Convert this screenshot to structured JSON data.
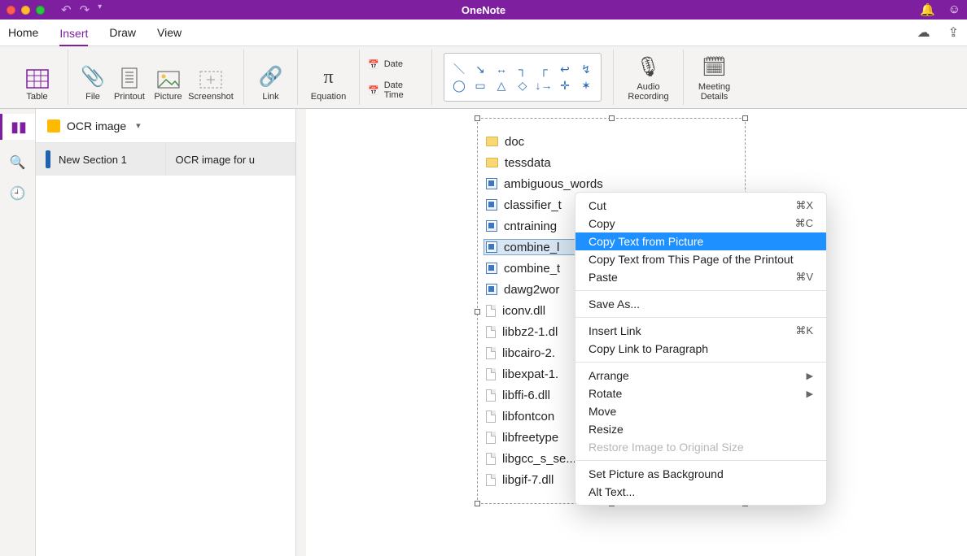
{
  "title": "OneNote",
  "menu": {
    "items": [
      "Home",
      "Insert",
      "Draw",
      "View"
    ],
    "active_index": 1
  },
  "ribbon": {
    "table": "Table",
    "file": "File",
    "printout": "Printout",
    "picture": "Picture",
    "screenshot": "Screenshot",
    "link": "Link",
    "equation": "Equation",
    "date": "Date",
    "date_time": "Date  Time",
    "audio_recording_l1": "Audio",
    "audio_recording_l2": "Recording",
    "meeting_details_l1": "Meeting",
    "meeting_details_l2": "Details"
  },
  "notebook": {
    "name": "OCR image",
    "section": "New Section 1",
    "page": "OCR image for u"
  },
  "embedded_files": [
    {
      "name": "doc",
      "type": "folder"
    },
    {
      "name": "tessdata",
      "type": "folder"
    },
    {
      "name": "ambiguous_words",
      "type": "exe"
    },
    {
      "name": "classifier_t",
      "type": "exe"
    },
    {
      "name": "cntraining",
      "type": "exe"
    },
    {
      "name": "combine_l",
      "type": "exe",
      "selected": true
    },
    {
      "name": "combine_t",
      "type": "exe"
    },
    {
      "name": "dawg2wor",
      "type": "exe"
    },
    {
      "name": "iconv.dll",
      "type": "dll"
    },
    {
      "name": "libbz2-1.dl",
      "type": "dll"
    },
    {
      "name": "libcairo-2.",
      "type": "dll"
    },
    {
      "name": "libexpat-1.",
      "type": "dll"
    },
    {
      "name": "libffi-6.dll",
      "type": "dll"
    },
    {
      "name": "libfontcon",
      "type": "dll"
    },
    {
      "name": "libfreetype",
      "type": "dll"
    },
    {
      "name": "libgcc_s_se...",
      "type": "dll"
    },
    {
      "name": "libgif-7.dll",
      "type": "dll"
    }
  ],
  "context_menu": {
    "groups": [
      [
        {
          "label": "Cut",
          "shortcut": "⌘X"
        },
        {
          "label": "Copy",
          "shortcut": "⌘C"
        },
        {
          "label": "Copy Text from Picture",
          "highlight": true
        },
        {
          "label": "Copy Text from This Page of the Printout"
        },
        {
          "label": "Paste",
          "shortcut": "⌘V"
        }
      ],
      [
        {
          "label": "Save As..."
        }
      ],
      [
        {
          "label": "Insert Link",
          "shortcut": "⌘K"
        },
        {
          "label": "Copy Link to Paragraph"
        }
      ],
      [
        {
          "label": "Arrange",
          "submenu": true
        },
        {
          "label": "Rotate",
          "submenu": true
        },
        {
          "label": "Move"
        },
        {
          "label": "Resize"
        },
        {
          "label": "Restore Image to Original Size",
          "disabled": true
        }
      ],
      [
        {
          "label": "Set Picture as Background"
        },
        {
          "label": "Alt Text..."
        }
      ]
    ]
  }
}
